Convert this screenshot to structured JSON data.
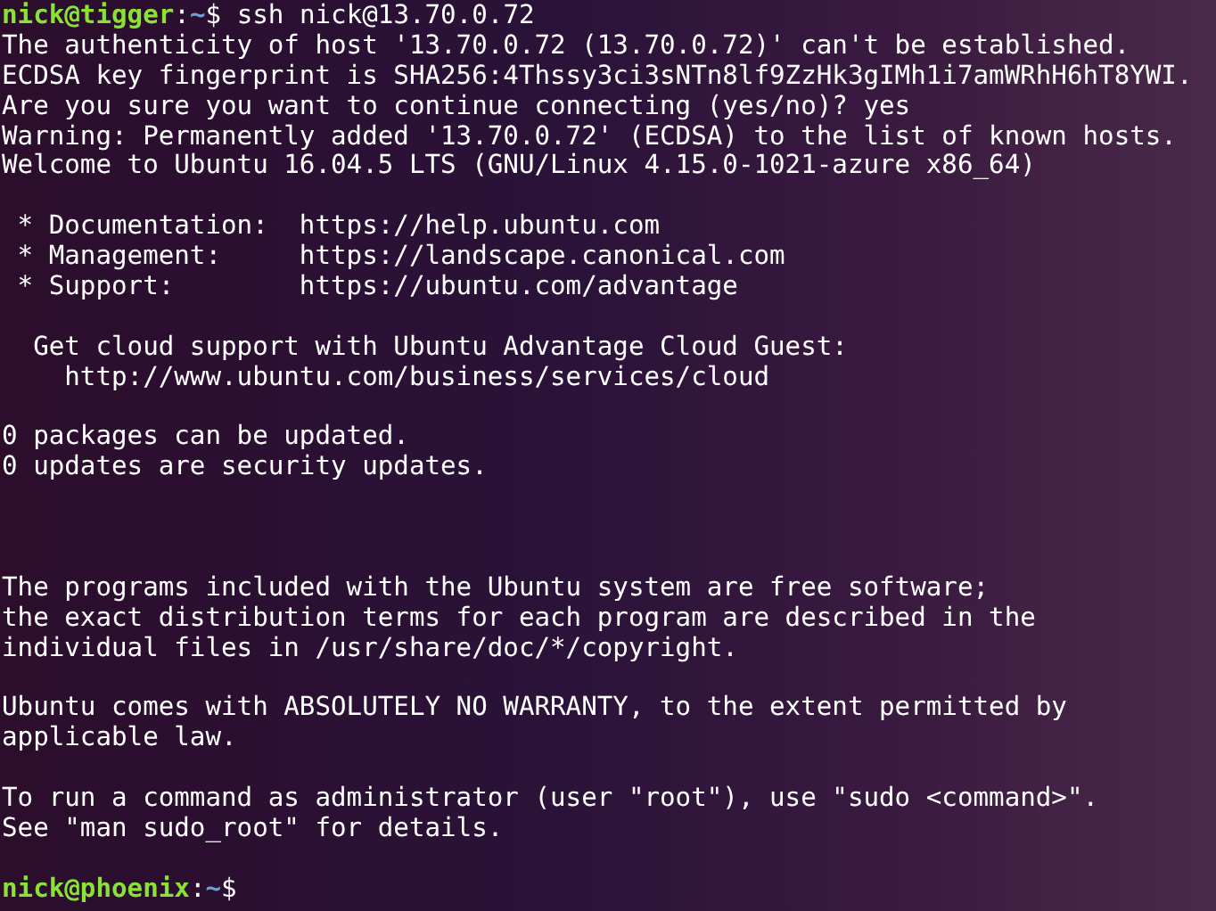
{
  "terminal": {
    "lines": [
      {
        "kind": "prompt",
        "user_host": "nick@tigger",
        "separator": ":",
        "path": "~",
        "symbol": "$",
        "command": " ssh nick@13.70.0.72"
      },
      {
        "kind": "text",
        "text": "The authenticity of host '13.70.0.72 (13.70.0.72)' can't be established."
      },
      {
        "kind": "text",
        "text": "ECDSA key fingerprint is SHA256:4Thssy3ci3sNTn8lf9ZzHk3gIMh1i7amWRhH6hT8YWI."
      },
      {
        "kind": "text",
        "text": "Are you sure you want to continue connecting (yes/no)? yes"
      },
      {
        "kind": "text",
        "text": "Warning: Permanently added '13.70.0.72' (ECDSA) to the list of known hosts."
      },
      {
        "kind": "text",
        "text": "Welcome to Ubuntu 16.04.5 LTS (GNU/Linux 4.15.0-1021-azure x86_64)"
      },
      {
        "kind": "blank"
      },
      {
        "kind": "text",
        "text": " * Documentation:  https://help.ubuntu.com"
      },
      {
        "kind": "text",
        "text": " * Management:     https://landscape.canonical.com"
      },
      {
        "kind": "text",
        "text": " * Support:        https://ubuntu.com/advantage"
      },
      {
        "kind": "blank"
      },
      {
        "kind": "text",
        "text": "  Get cloud support with Ubuntu Advantage Cloud Guest:"
      },
      {
        "kind": "text",
        "text": "    http://www.ubuntu.com/business/services/cloud"
      },
      {
        "kind": "blank"
      },
      {
        "kind": "text",
        "text": "0 packages can be updated."
      },
      {
        "kind": "text",
        "text": "0 updates are security updates."
      },
      {
        "kind": "blank"
      },
      {
        "kind": "blank"
      },
      {
        "kind": "blank"
      },
      {
        "kind": "text",
        "text": "The programs included with the Ubuntu system are free software;"
      },
      {
        "kind": "text",
        "text": "the exact distribution terms for each program are described in the"
      },
      {
        "kind": "text",
        "text": "individual files in /usr/share/doc/*/copyright."
      },
      {
        "kind": "blank"
      },
      {
        "kind": "text",
        "text": "Ubuntu comes with ABSOLUTELY NO WARRANTY, to the extent permitted by"
      },
      {
        "kind": "text",
        "text": "applicable law."
      },
      {
        "kind": "blank"
      },
      {
        "kind": "text",
        "text": "To run a command as administrator (user \"root\"), use \"sudo <command>\"."
      },
      {
        "kind": "text",
        "text": "See \"man sudo_root\" for details."
      },
      {
        "kind": "blank"
      },
      {
        "kind": "prompt",
        "user_host": "nick@phoenix",
        "separator": ":",
        "path": "~",
        "symbol": "$"
      }
    ]
  }
}
